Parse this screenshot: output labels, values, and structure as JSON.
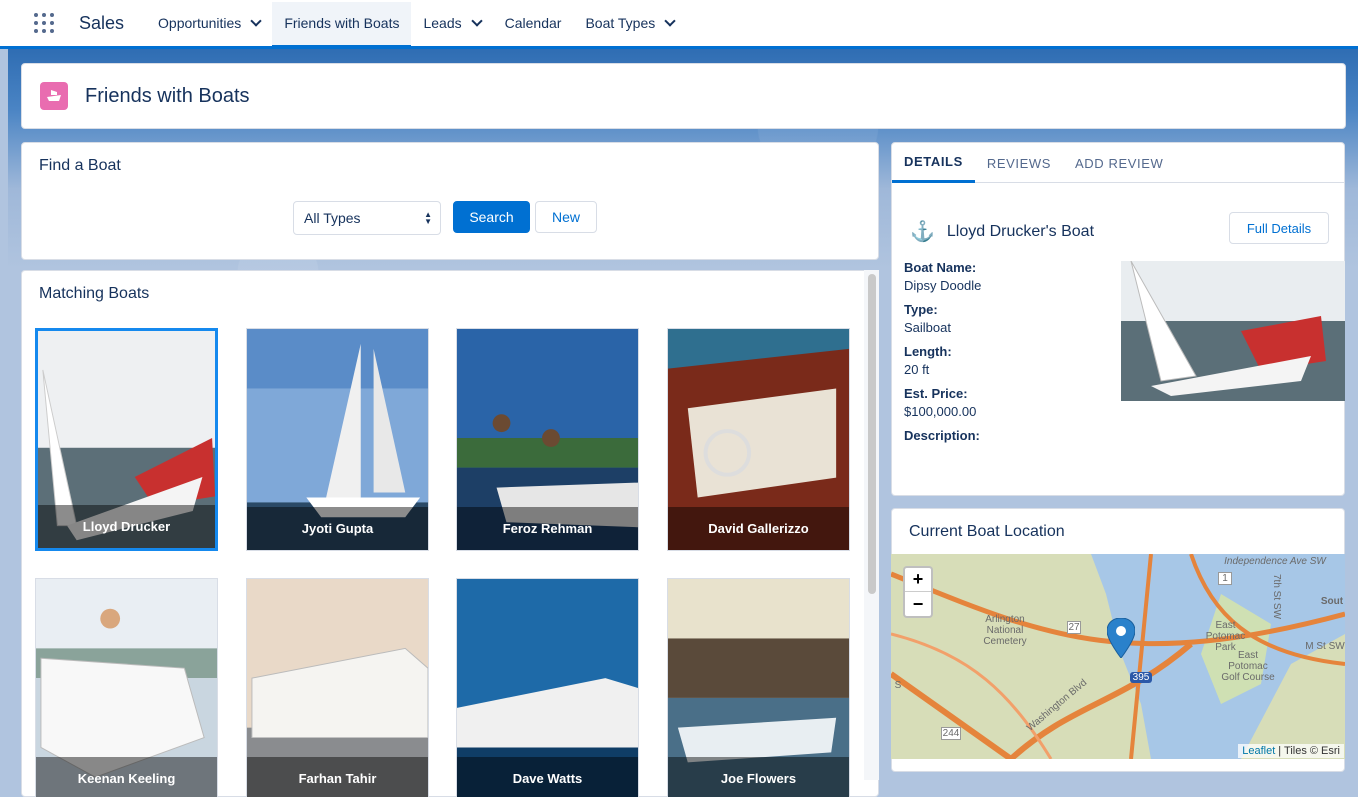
{
  "nav": {
    "app_name": "Sales",
    "items": [
      {
        "label": "Opportunities",
        "dropdown": true
      },
      {
        "label": "Friends with Boats",
        "dropdown": false,
        "active": true
      },
      {
        "label": "Leads",
        "dropdown": true
      },
      {
        "label": "Calendar",
        "dropdown": false
      },
      {
        "label": "Boat Types",
        "dropdown": true
      }
    ]
  },
  "page": {
    "title": "Friends with Boats",
    "icon": "boat-icon",
    "icon_color": "#e96cb0"
  },
  "find": {
    "title": "Find a Boat",
    "type_select_value": "All Types",
    "search_label": "Search",
    "new_label": "New"
  },
  "matching": {
    "title": "Matching Boats",
    "tiles": [
      {
        "owner": "Lloyd Drucker",
        "selected": true
      },
      {
        "owner": "Jyoti Gupta"
      },
      {
        "owner": "Feroz Rehman"
      },
      {
        "owner": "David Gallerizzo"
      },
      {
        "owner": "Keenan Keeling"
      },
      {
        "owner": "Farhan Tahir"
      },
      {
        "owner": "Dave Watts"
      },
      {
        "owner": "Joe Flowers"
      }
    ]
  },
  "detail": {
    "tabs": [
      "DETAILS",
      "REVIEWS",
      "ADD REVIEW"
    ],
    "boat_title": "Lloyd Drucker's Boat",
    "full_details_label": "Full Details",
    "fields": {
      "name_label": "Boat Name:",
      "name_value": "Dipsy Doodle",
      "type_label": "Type:",
      "type_value": "Sailboat",
      "length_label": "Length:",
      "length_value": "20 ft",
      "price_label": "Est. Price:",
      "price_value": "$100,000.00",
      "description_label": "Description:"
    }
  },
  "map": {
    "title": "Current Boat Location",
    "zoom_in": "+",
    "zoom_out": "−",
    "attribution_link": "Leaflet",
    "attribution_rest": " | Tiles © Esri",
    "labels": {
      "cemetery": "Arlington National Cemetery",
      "street_top": "Independence Ave SW",
      "street_m": "M St SW",
      "south": "Sout",
      "east_potomac": "East Potomac Park",
      "golf": "East Potomac Golf Course",
      "washington_blvd": "Washington Blvd",
      "route_27": "27",
      "route_1": "1",
      "route_395": "395",
      "route_244": "244",
      "seventh_st": "7th St SW",
      "marker_s": "S"
    }
  }
}
